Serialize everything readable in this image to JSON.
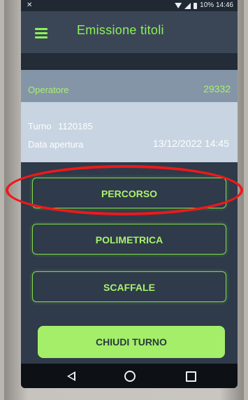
{
  "status_bar": {
    "left": "✕",
    "right_text": "10% 14:46"
  },
  "header": {
    "menu_icon": "hamburger-menu-icon",
    "title": "Emissione titoli"
  },
  "operator": {
    "label": "Operatore",
    "value": "29332"
  },
  "shift": {
    "turno_label": "Turno",
    "turno_value": "1120185",
    "data_label": "Data apertura",
    "data_value": "13/12/2022 14:45"
  },
  "buttons": {
    "percorso": "PERCORSO",
    "polimetrica": "POLIMETRICA",
    "scaffale": "SCAFFALE",
    "chiudi": "CHIUDI TURNO"
  },
  "navbar": {
    "back_icon": "back-triangle-icon",
    "home_icon": "home-circle-icon",
    "recent_icon": "recent-apps-square-icon"
  },
  "colors": {
    "accent_green": "#8df05a",
    "app_background": "#2f3a4a",
    "annotation_red": "#ee1919"
  }
}
